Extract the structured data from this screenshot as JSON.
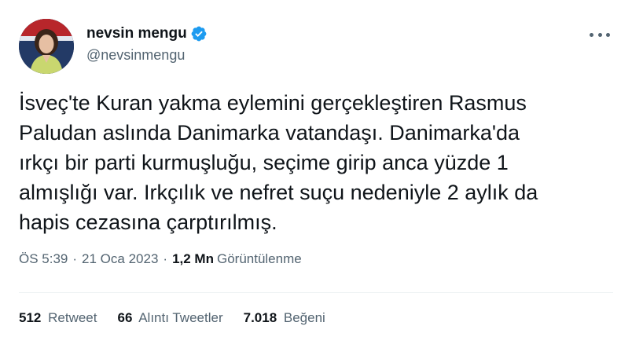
{
  "author": {
    "display_name": "nevsin mengu",
    "handle": "@nevsinmengu",
    "verified_icon": "verified-badge-icon",
    "badge_color": "#1d9bf0"
  },
  "tweet": {
    "text": "İsveç'te Kuran yakma eylemini gerçekleştiren Rasmus\nPaludan aslında Danimarka vatandaşı. Danimarka'da\nırkçı bir parti kurmuşluğu, seçime girip anca yüzde 1\nalmışlığı var. Irkçılık ve nefret suçu nedeniyle 2 aylık da\nhapis cezasına çarptırılmış.",
    "time": "ÖS 5:39",
    "date": "21 Oca 2023",
    "views_count": "1,2 Mn",
    "views_label": "Görüntülenme"
  },
  "stats": {
    "retweets_count": "512",
    "retweets_label": "Retweet",
    "quotes_count": "66",
    "quotes_label": "Alıntı Tweetler",
    "likes_count": "7.018",
    "likes_label": "Beğeni"
  },
  "colors": {
    "text": "#0f1419",
    "secondary": "#536471",
    "divider": "#eff3f4"
  }
}
